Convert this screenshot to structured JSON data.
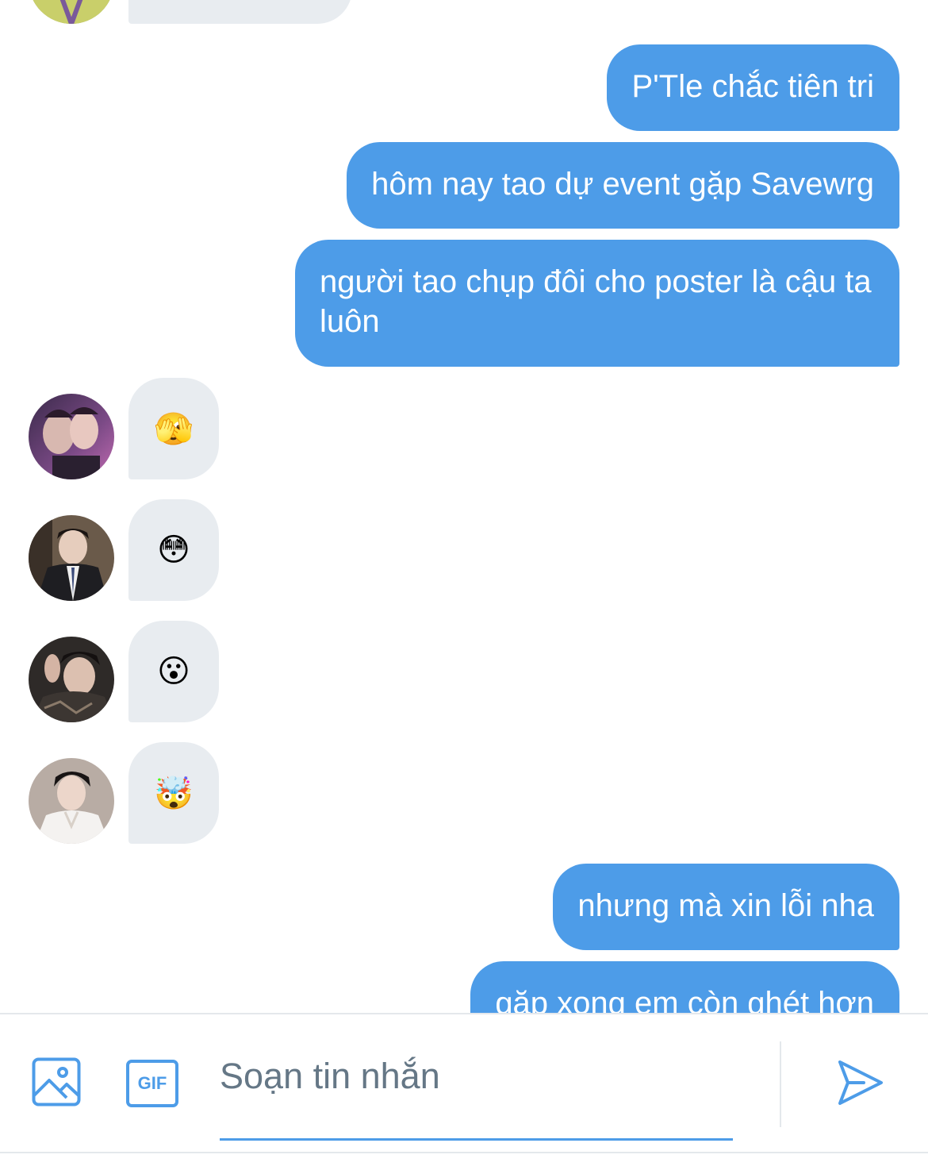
{
  "theme": {
    "accent": "#4d9ce8",
    "incoming_bubble": "#e8ecf0",
    "placeholder": "#657786"
  },
  "messages": {
    "outgoing": [
      {
        "text": "P'Tle chắc tiên tri"
      },
      {
        "text": "hôm nay tao dự event gặp Savewrg"
      },
      {
        "text": "người tao chụp đôi cho poster là cậu ta luôn"
      },
      {
        "text": "nhưng mà xin lỗi nha"
      },
      {
        "text": "gặp xong em còn ghét hơn"
      }
    ],
    "incoming": [
      {
        "emoji": "🫣",
        "emoji_name": "face-with-peeking-eye"
      },
      {
        "emoji": "😳",
        "emoji_name": "flushed-face"
      },
      {
        "emoji": "😮",
        "emoji_name": "face-with-open-mouth"
      },
      {
        "emoji": "🤯",
        "emoji_name": "exploding-head"
      }
    ]
  },
  "composer": {
    "placeholder": "Soạn tin nhắn",
    "value": "",
    "gif_label": "GIF",
    "media_icon": "image-icon",
    "send_icon": "send-icon"
  }
}
